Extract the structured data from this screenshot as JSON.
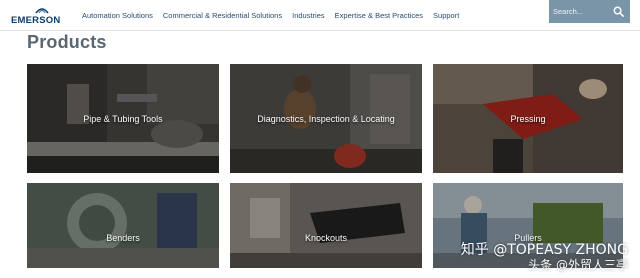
{
  "brand": {
    "name": "EMERSON",
    "color": "#0b3d6e"
  },
  "nav": {
    "items": [
      "Automation Solutions",
      "Commercial & Residential Solutions",
      "Industries",
      "Expertise & Best Practices",
      "Support"
    ]
  },
  "search": {
    "placeholder": "Search...",
    "icon": "search-icon",
    "bg_color": "#7a95a8"
  },
  "page_title": "Products",
  "products": [
    {
      "label": "Pipe & Tubing Tools"
    },
    {
      "label": "Diagnostics, Inspection & Locating"
    },
    {
      "label": "Pressing"
    },
    {
      "label": "Benders"
    },
    {
      "label": "Knockouts"
    },
    {
      "label": "Pullers"
    }
  ],
  "watermark": {
    "line1": "知乎 @TOPEASY ZHONG",
    "line2": "头条 @外贸人三亭"
  }
}
